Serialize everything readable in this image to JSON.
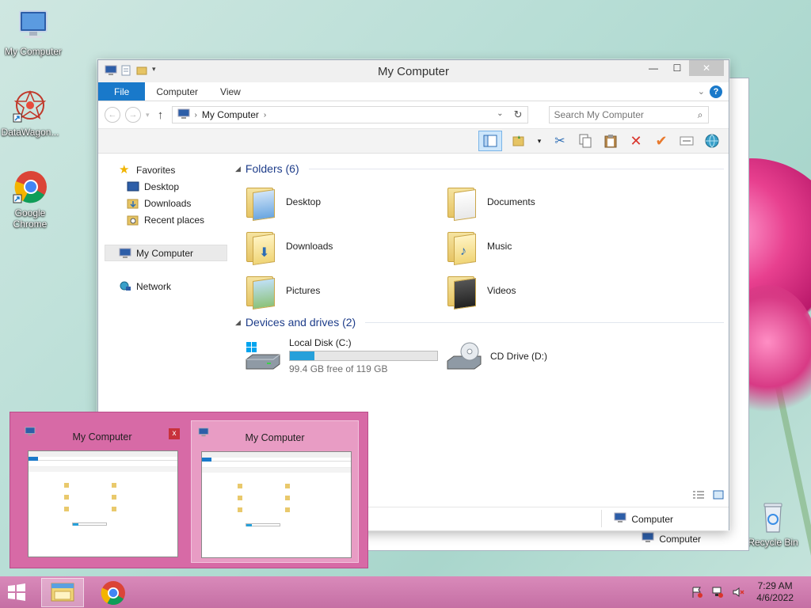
{
  "desktop": {
    "icons": [
      {
        "label": "My Computer"
      },
      {
        "label": "DataWagon..."
      },
      {
        "label": "Google Chrome"
      },
      {
        "label": "Recycle Bin"
      }
    ]
  },
  "window": {
    "title": "My Computer",
    "ribbon_tabs": [
      "File",
      "Computer",
      "View"
    ],
    "help": "?",
    "address": {
      "path": "My Computer"
    },
    "search": {
      "placeholder": "Search My Computer"
    },
    "nav": {
      "favorites": "Favorites",
      "desktop": "Desktop",
      "downloads": "Downloads",
      "recent": "Recent places",
      "mycomputer": "My Computer",
      "network": "Network"
    },
    "groups": {
      "folders": "Folders (6)",
      "devices": "Devices and drives (2)"
    },
    "folders": [
      "Desktop",
      "Documents",
      "Downloads",
      "Music",
      "Pictures",
      "Videos"
    ],
    "drives": [
      {
        "name": "Local Disk (C:)",
        "free": "99.4 GB free of 119 GB",
        "used_fraction": 0.165
      },
      {
        "name": "CD Drive (D:)"
      }
    ],
    "status": {
      "location": "Computer"
    }
  },
  "back_window": {
    "status": "Computer"
  },
  "thumbnails": [
    {
      "title": "My Computer",
      "close": "x"
    },
    {
      "title": "My Computer"
    }
  ],
  "taskbar": {
    "time": "7:29 AM",
    "date": "4/6/2022"
  },
  "colors": {
    "accent": "#1979ca",
    "taskbar": "#c56fa4",
    "progress": "#26a0da"
  }
}
